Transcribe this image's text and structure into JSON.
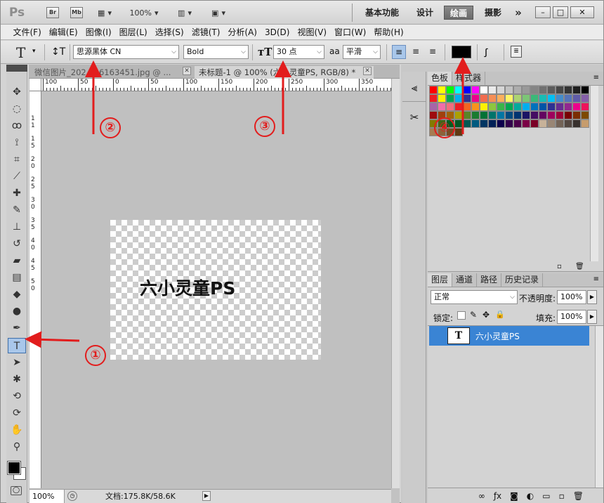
{
  "app": {
    "logo": "Ps"
  },
  "topbar": {
    "buttons": [
      "Br",
      "Mb"
    ],
    "zoom": "100%",
    "workspaces": [
      "基本功能",
      "设计",
      "绘画",
      "摄影"
    ],
    "active_workspace": "绘画",
    "more": "»"
  },
  "menu": [
    "文件(F)",
    "编辑(E)",
    "图像(I)",
    "图层(L)",
    "选择(S)",
    "滤镜(T)",
    "分析(A)",
    "3D(D)",
    "视图(V)",
    "窗口(W)",
    "帮助(H)"
  ],
  "options": {
    "tool_glyph": "T",
    "font_family": "思源黑体 CN",
    "font_style": "Bold",
    "font_size": "30 点",
    "antialias": "平滑",
    "aa_glyph": "aa",
    "color": "#000000"
  },
  "tabs": [
    {
      "label": "微信图片_202   126163451.jpg @ ...",
      "active": false
    },
    {
      "label": "未标题-1 @ 100% (六小灵童PS, RGB/8) *",
      "active": true
    }
  ],
  "ruler": {
    "h_labels": [
      "100",
      "50",
      "0",
      "50",
      "100",
      "150",
      "200",
      "250",
      "300",
      "350"
    ],
    "v_labels": [
      "1",
      "1",
      "1",
      "5",
      "2",
      "0",
      "2",
      "5",
      "3",
      "0",
      "3",
      "5",
      "4",
      "0",
      "4",
      "5",
      "5",
      "0"
    ]
  },
  "canvas": {
    "text": "六小灵童PS"
  },
  "status": {
    "zoom": "100%",
    "doc": "文档:175.8K/58.6K"
  },
  "swatch_panel": {
    "tabs": [
      "色板",
      "样式器"
    ]
  },
  "layers_panel": {
    "tabs": [
      "图层",
      "通道",
      "路径",
      "历史记录"
    ],
    "blend_mode": "正常",
    "opacity_label": "不透明度:",
    "opacity": "100%",
    "lock_label": "锁定:",
    "fill_label": "填充:",
    "fill": "100%",
    "layer_name": "六小灵童PS",
    "layer_thumb": "T"
  },
  "annotations": [
    "①",
    "②",
    "③",
    "④"
  ],
  "colors": {
    "accent": "#e21d1d",
    "layer_selected": "#3a84d4",
    "active_ws": "#6b6b6b"
  }
}
